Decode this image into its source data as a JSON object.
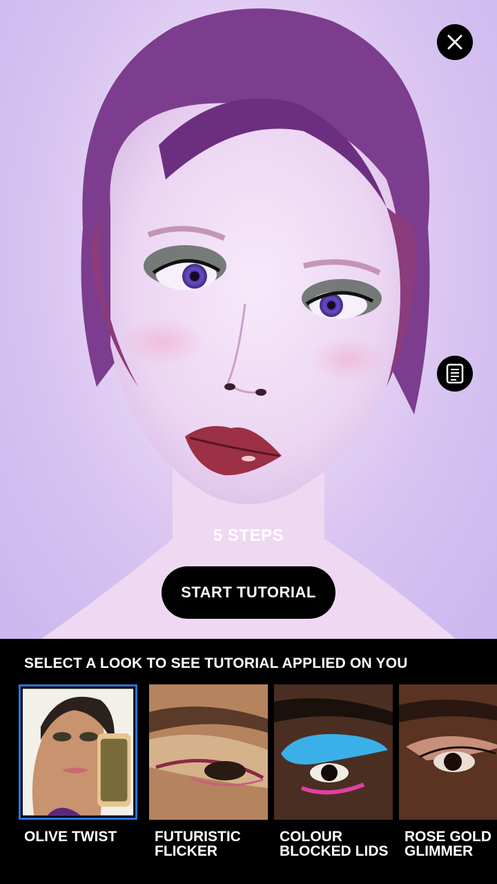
{
  "camera": {
    "close_icon": "close-icon",
    "notes_icon": "notes-icon",
    "steps_text": "5 STEPS",
    "start_button_label": "START TUTORIAL"
  },
  "panel": {
    "title": "SELECT A LOOK TO SEE TUTORIAL APPLIED ON YOU",
    "looks": [
      {
        "label": "OLIVE TWIST",
        "selected": true
      },
      {
        "label": "FUTURISTIC FLICKER",
        "selected": false
      },
      {
        "label": "COLOUR BLOCKED LIDS",
        "selected": false
      },
      {
        "label": "ROSE GOLD GLIMMER",
        "selected": false
      }
    ],
    "selection_color": "#2b74e0"
  }
}
